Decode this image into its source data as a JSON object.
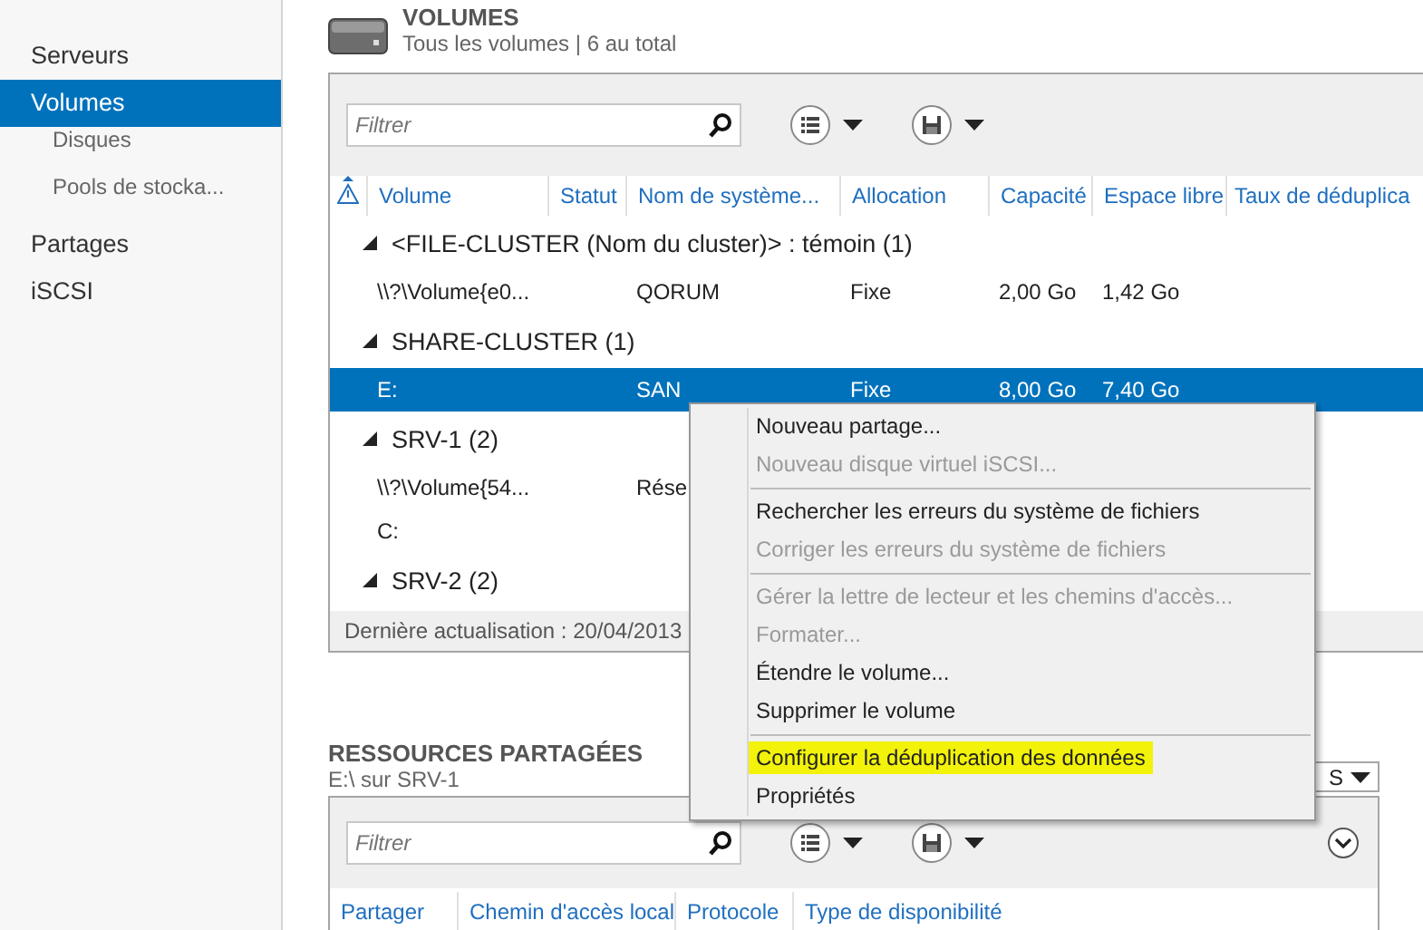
{
  "sidebar": {
    "items": [
      {
        "label": "Serveurs",
        "selected": false
      },
      {
        "label": "Volumes",
        "selected": true,
        "children": [
          {
            "label": "Disques",
            "selected": false
          },
          {
            "label": "Pools de stocka...",
            "selected": false
          }
        ]
      },
      {
        "label": "Partages",
        "selected": false
      },
      {
        "label": "iSCSI",
        "selected": false
      }
    ]
  },
  "volumes": {
    "title": "VOLUMES",
    "subtitle": "Tous les volumes | 6 au total",
    "filter": {
      "placeholder": "Filtrer"
    },
    "table": {
      "columns": [
        "Volume",
        "Statut",
        "Nom de système...",
        "Allocation",
        "Capacité",
        "Espace libre",
        "Taux de déduplica"
      ],
      "groups": [
        {
          "label": "<FILE-CLUSTER (Nom du cluster)> : témoin (1)",
          "expanded": true,
          "rows": [
            {
              "cells": [
                "\\\\?\\Volume{e0...",
                "",
                "QORUM",
                "Fixe",
                "2,00 Go",
                "1,42 Go",
                ""
              ],
              "selected": false
            }
          ]
        },
        {
          "label": "SHARE-CLUSTER (1)",
          "expanded": true,
          "rows": [
            {
              "cells": [
                "E:",
                "",
                "SAN",
                "Fixe",
                "8,00 Go",
                "7,40 Go",
                ""
              ],
              "selected": true
            }
          ]
        },
        {
          "label": "SRV-1 (2)",
          "expanded": true,
          "rows": [
            {
              "cells": [
                "\\\\?\\Volume{54...",
                "",
                "Rése",
                "",
                "",
                "",
                ""
              ],
              "selected": false
            },
            {
              "cells": [
                "C:",
                "",
                "",
                "",
                "",
                "",
                ""
              ],
              "selected": false
            }
          ]
        },
        {
          "label": "SRV-2 (2)",
          "expanded": true
        }
      ]
    },
    "status": "Dernière actualisation : 20/04/2013"
  },
  "shares": {
    "title": "RESSOURCES PARTAGÉES",
    "subtitle": "E:\\ sur SRV-1",
    "tasks": "S",
    "filter": {
      "placeholder": "Filtrer"
    },
    "columns": [
      "Partager",
      "Chemin d'accès local",
      "Protocole",
      "Type de disponibilité"
    ]
  },
  "context_menu": {
    "items": [
      {
        "kind": "item",
        "label": "Nouveau partage...",
        "disabled": false,
        "highlighted": false
      },
      {
        "kind": "item",
        "label": "Nouveau disque virtuel iSCSI...",
        "disabled": true,
        "highlighted": false
      },
      {
        "kind": "separator"
      },
      {
        "kind": "item",
        "label": "Rechercher les erreurs du système de fichiers",
        "disabled": false,
        "highlighted": false
      },
      {
        "kind": "item",
        "label": "Corriger les erreurs du système de fichiers",
        "disabled": true,
        "highlighted": false
      },
      {
        "kind": "separator"
      },
      {
        "kind": "item",
        "label": "Gérer la lettre de lecteur et les chemins d'accès...",
        "disabled": true,
        "highlighted": false
      },
      {
        "kind": "item",
        "label": "Formater...",
        "disabled": true,
        "highlighted": false
      },
      {
        "kind": "item",
        "label": "Étendre le volume...",
        "disabled": false,
        "highlighted": false
      },
      {
        "kind": "item",
        "label": "Supprimer le volume",
        "disabled": false,
        "highlighted": false
      },
      {
        "kind": "separator"
      },
      {
        "kind": "item",
        "label": "Configurer la déduplication des données",
        "disabled": false,
        "highlighted": true
      },
      {
        "kind": "item",
        "label": "Propriétés",
        "disabled": false,
        "highlighted": false
      }
    ]
  }
}
